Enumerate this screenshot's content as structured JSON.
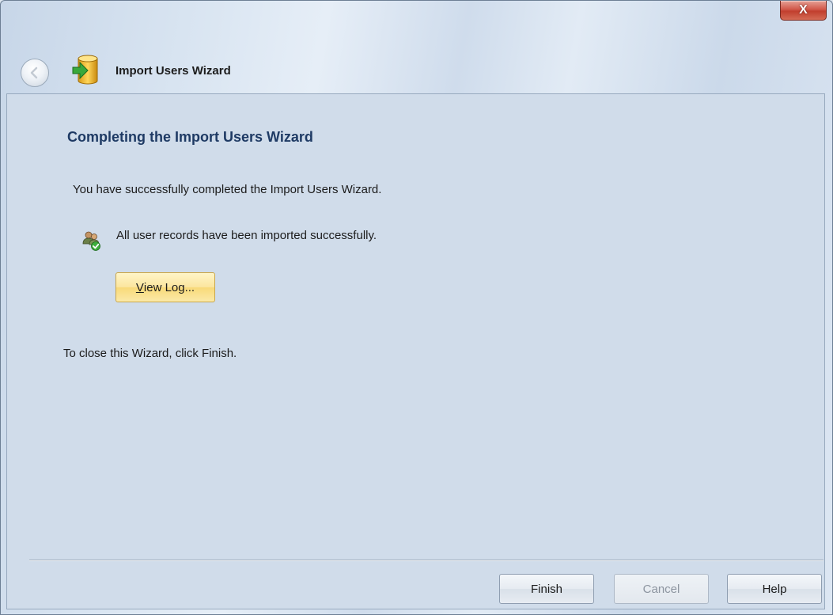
{
  "window": {
    "title": "Import Users Wizard",
    "close_glyph": "X"
  },
  "page": {
    "heading": "Completing the Import Users Wizard",
    "completed_text": "You have successfully completed the Import Users Wizard.",
    "status_text": "All user records have been imported successfully.",
    "close_hint": "To close this Wizard, click Finish."
  },
  "view_log": {
    "mnemonic": "V",
    "rest": "iew Log..."
  },
  "buttons": {
    "finish": "Finish",
    "cancel": "Cancel",
    "help": "Help"
  },
  "icons": {
    "back": "back-arrow-icon",
    "wizard": "database-import-icon",
    "status": "users-check-icon"
  },
  "colors": {
    "heading": "#1e3a64",
    "close_button": "#c13f2e",
    "view_log_button": "#fbe59d"
  }
}
